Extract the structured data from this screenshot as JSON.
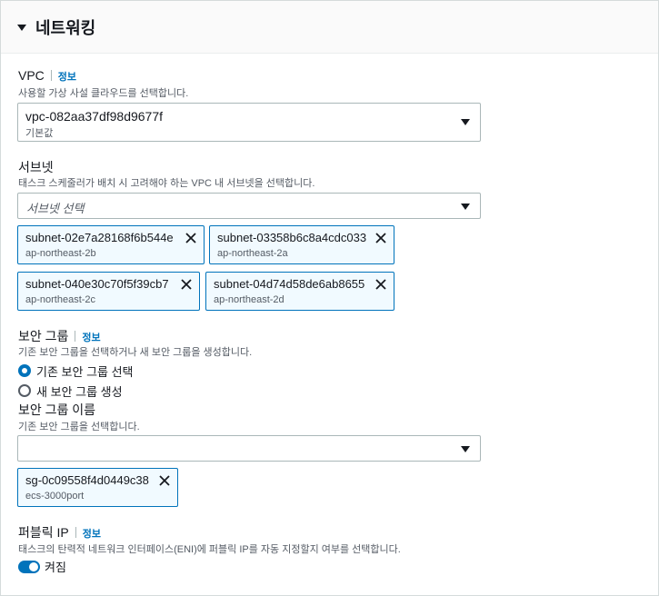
{
  "section": {
    "title": "네트워킹"
  },
  "vpc": {
    "label": "VPC",
    "info": "정보",
    "description": "사용할 가상 사설 클라우드를 선택합니다.",
    "value": "vpc-082aa37df98d9677f",
    "value_sub": "기본값"
  },
  "subnets": {
    "label": "서브넷",
    "description": "태스크 스케줄러가 배치 시 고려해야 하는 VPC 내 서브넷을 선택합니다.",
    "placeholder": "서브넷 선택",
    "tokens": [
      {
        "id": "subnet-02e7a28168f6b544e",
        "az": "ap-northeast-2b"
      },
      {
        "id": "subnet-03358b6c8a4cdc033",
        "az": "ap-northeast-2a"
      },
      {
        "id": "subnet-040e30c70f5f39cb7",
        "az": "ap-northeast-2c"
      },
      {
        "id": "subnet-04d74d58de6ab8655",
        "az": "ap-northeast-2d"
      }
    ]
  },
  "security_group": {
    "label": "보안 그룹",
    "info": "정보",
    "description": "기존 보안 그룹을 선택하거나 새 보안 그룹을 생성합니다.",
    "options": [
      {
        "label": "기존 보안 그룹 선택",
        "selected": true
      },
      {
        "label": "새 보안 그룹 생성",
        "selected": false
      }
    ],
    "name_label": "보안 그룹 이름",
    "name_description": "기존 보안 그룹을 선택합니다.",
    "name_value": "",
    "tokens": [
      {
        "id": "sg-0c09558f4d0449c38",
        "name": "ecs-3000port"
      }
    ]
  },
  "public_ip": {
    "label": "퍼블릭 IP",
    "info": "정보",
    "description": "태스크의 탄력적 네트워크 인터페이스(ENI)에 퍼블릭 IP를 자동 지정할지 여부를 선택합니다.",
    "toggle_label": "켜짐",
    "enabled": true
  },
  "colors": {
    "accent": "#0073bb",
    "token_bg": "#f1faff",
    "text": "#16191f",
    "muted": "#545b64"
  }
}
